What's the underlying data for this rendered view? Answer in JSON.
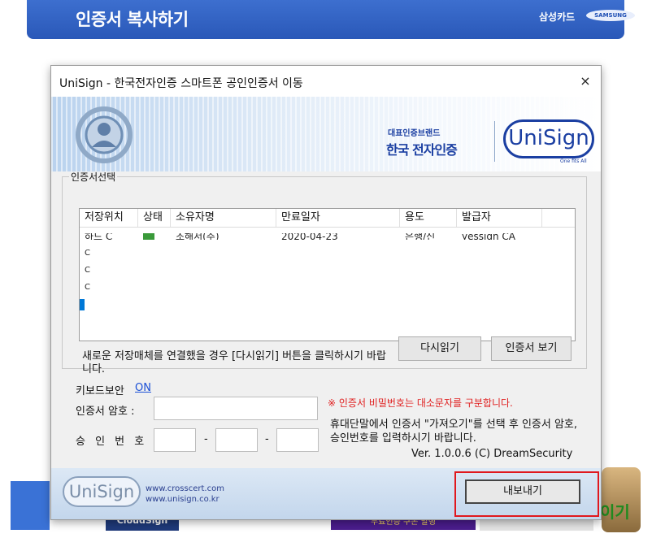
{
  "page": {
    "title": "인증서 복사하기",
    "brand": "삼성카드",
    "samsung_logo": "SAMSUNG",
    "strip_left_text": "CloudSign",
    "strip_mid_text": "무료인증 쿠폰 발행",
    "avatar_text": "이기"
  },
  "dialog": {
    "title": "UniSign - 한국전자인증 스마트폰 공인인증서 이동",
    "close_icon": "×",
    "banner": {
      "brand_small": "대표인증브랜드",
      "brand": "한국 전자인증",
      "logo": "UniSign",
      "logo_sub": "One fits All"
    },
    "cert_group": {
      "legend": "인증서선택",
      "columns": [
        "저장위치",
        "상태",
        "소유자명",
        "만료일자",
        "용도",
        "발급자"
      ],
      "rows": [
        {
          "location": "하드 C",
          "owner": "조해서(주)",
          "expiry": "2020-04-23",
          "usage": "은행/신",
          "issuer": "yessign CA"
        },
        {
          "location": "C",
          "owner": "",
          "expiry": "",
          "usage": "",
          "issuer": ""
        },
        {
          "location": "C",
          "owner": "",
          "expiry": "",
          "usage": "",
          "issuer": ""
        },
        {
          "location": "C",
          "owner": "",
          "expiry": "",
          "usage": "",
          "issuer": ""
        },
        {
          "location": "C",
          "owner": "",
          "expiry": "",
          "usage": "",
          "issuer": ""
        }
      ],
      "notice": "새로운 저장매체를 연결했을 경우 [다시읽기] 버튼을 클릭하시기 바랍니다.",
      "reload_button": "다시읽기",
      "view_button": "인증서 보기"
    },
    "keyboard_security_label": "키보드보안",
    "keyboard_security_value": "ON",
    "password_label": "인증서 암호 :",
    "password_warning": "※ 인증서 비밀번호는 대소문자를 구분합니다.",
    "auth_label": "승 인 번 호 :",
    "auth_dash": "-",
    "help_text": "휴대단말에서 인증서 \"가져오기\"를 선택 후 인증서 암호, 승인번호를 입력하시기 바랍니다.",
    "version": "Ver. 1.0.0.6  (C) DreamSecurity",
    "footer": {
      "logo": "UniSign",
      "link1": "www.crosscert.com",
      "link2": "www.unisign.co.kr",
      "export_button": "내보내기"
    }
  },
  "colors": {
    "header_blue": "#2a58b8",
    "highlight_red": "#e0181e",
    "link_blue": "#1a4fd6",
    "warning_red": "#e02020"
  }
}
